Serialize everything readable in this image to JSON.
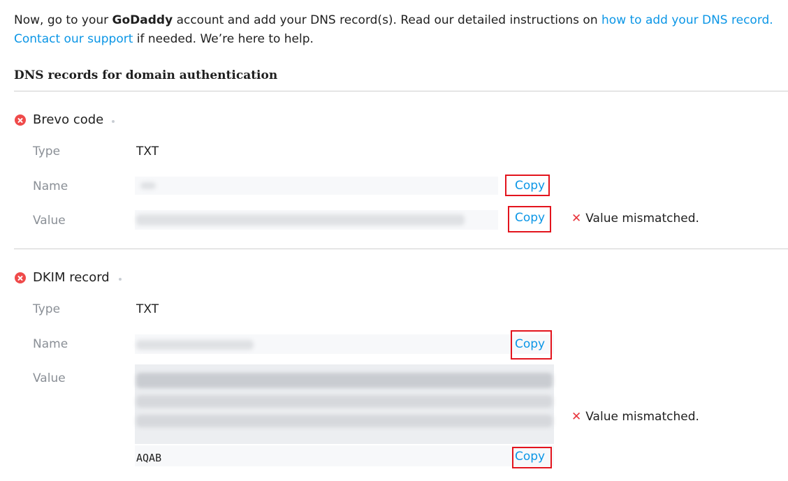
{
  "intro": {
    "part1": "Now, go to your ",
    "brand": "GoDaddy",
    "part2": " account and add your DNS record(s). Read our detailed instructions on ",
    "link1": "how to add your DNS record.",
    "link2": "Contact our support",
    "part3": " if needed. We’re here to help."
  },
  "section_title": "DNS records for domain authentication",
  "records": [
    {
      "title": "Brevo code",
      "type_label": "Type",
      "type_value": "TXT",
      "name_label": "Name",
      "value_label": "Value",
      "copy_label": "Copy",
      "status": "Value mismatched."
    },
    {
      "title": "DKIM record",
      "type_label": "Type",
      "type_value": "TXT",
      "name_label": "Name",
      "value_label": "Value",
      "copy_label": "Copy",
      "value_suffix": "AQAB",
      "status": "Value mismatched."
    }
  ],
  "colors": {
    "link": "#0b96e6",
    "error": "#ef4a4a",
    "highlight": "#e3141d"
  }
}
